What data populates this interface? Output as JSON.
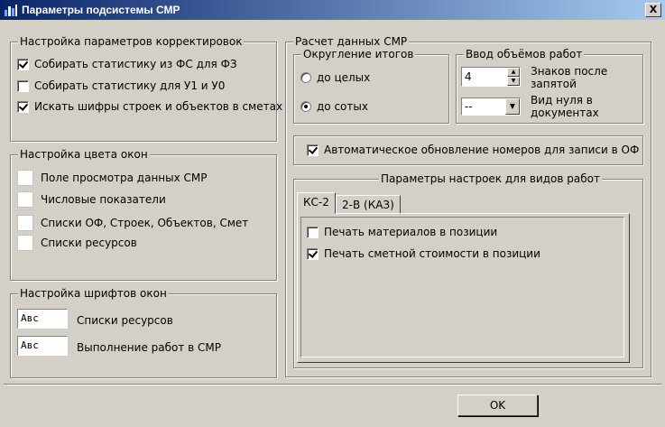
{
  "window": {
    "title": "Параметры подсистемы СМР",
    "close_label": "X"
  },
  "correct": {
    "legend": "Настройка параметров корректировок",
    "items": [
      {
        "label": "Собирать статистику из ФС для ФЗ",
        "checked": true
      },
      {
        "label": "Собирать статистику для У1 и  У0",
        "checked": false
      },
      {
        "label": "Искать шифры строек и объектов в сметах",
        "checked": true
      }
    ]
  },
  "colors": {
    "legend": "Настройка цвета окон",
    "items": [
      "Поле просмотра данных  СМР",
      "Числовые показатели",
      "Списки  ОФ, Строек, Объектов, Смет",
      "Списки ресурсов"
    ]
  },
  "fonts": {
    "legend": "Настройка шрифтов окон",
    "items": [
      {
        "sample": "Авс",
        "label": "Списки ресурсов"
      },
      {
        "sample": "Авс",
        "label": "Выполнение работ в СМР"
      }
    ]
  },
  "calc": {
    "legend": "Расчет данных СМР",
    "rounding": {
      "legend": "Округление итогов",
      "options": [
        {
          "label": "до целых",
          "selected": false
        },
        {
          "label": "до сотых",
          "selected": true
        }
      ]
    },
    "volumes": {
      "legend": "Ввод объёмов работ",
      "decimals_value": "4",
      "decimals_label": "Знаков после запятой",
      "zero_value": "--",
      "zero_label": "Вид нуля в документах"
    },
    "auto_update": {
      "label": "Автоматическое обновление номеров для записи в ОФ",
      "checked": true
    },
    "work_params": {
      "legend": "Параметры настроек для видов работ",
      "tabs": [
        "КС-2",
        "2-В (КАЗ)"
      ],
      "items": [
        {
          "label": "Печать материалов в позиции",
          "checked": false
        },
        {
          "label": "Печать сметной стоимости в позиции",
          "checked": true
        }
      ]
    }
  },
  "ok_label": "OK",
  "accent": "#0a246a"
}
